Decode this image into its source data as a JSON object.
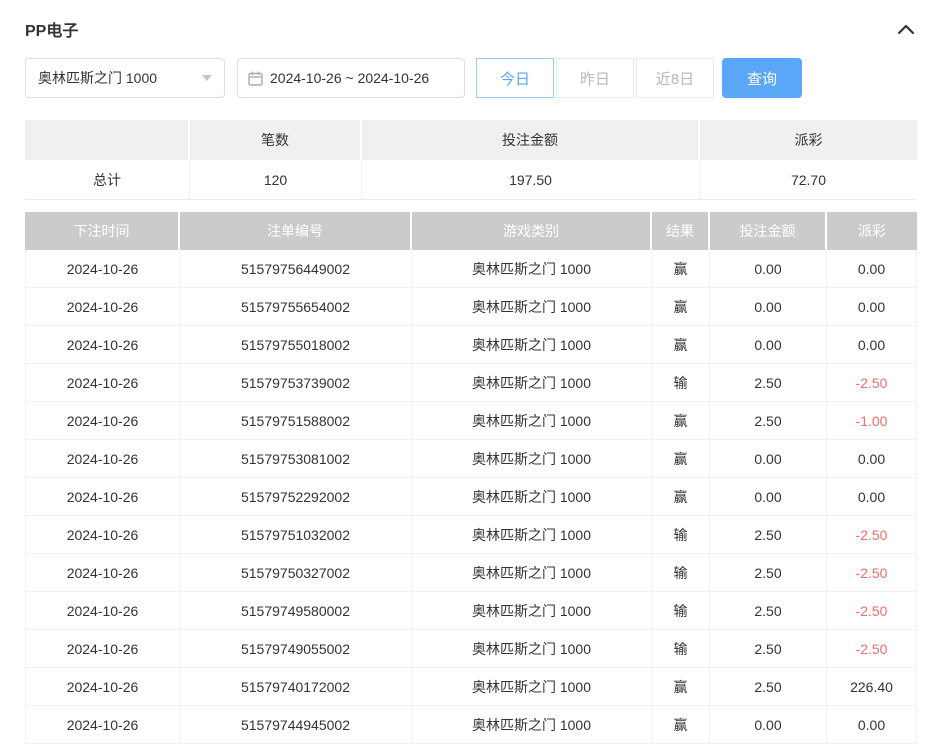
{
  "panel": {
    "title": "PP电子"
  },
  "filters": {
    "game_select": {
      "value": "奥林匹斯之门 1000"
    },
    "date_range": {
      "value": "2024-10-26 ~ 2024-10-26"
    },
    "quick_buttons": [
      {
        "label": "今日",
        "active": true
      },
      {
        "label": "昨日",
        "active": false
      },
      {
        "label": "近8日",
        "active": false
      }
    ],
    "search_button": "查询"
  },
  "summary": {
    "headers": [
      "",
      "笔数",
      "投注金额",
      "派彩"
    ],
    "total": {
      "label": "总计",
      "count": "120",
      "bet_amount": "197.50",
      "payout": "72.70"
    }
  },
  "table": {
    "headers": [
      "下注时间",
      "注单编号",
      "游戏类别",
      "结果",
      "投注金额",
      "派彩"
    ],
    "rows": [
      [
        "2024-10-26",
        "51579756449002",
        "奥林匹斯之门 1000",
        "赢",
        "0.00",
        "0.00"
      ],
      [
        "2024-10-26",
        "51579755654002",
        "奥林匹斯之门 1000",
        "赢",
        "0.00",
        "0.00"
      ],
      [
        "2024-10-26",
        "51579755018002",
        "奥林匹斯之门 1000",
        "赢",
        "0.00",
        "0.00"
      ],
      [
        "2024-10-26",
        "51579753739002",
        "奥林匹斯之门 1000",
        "输",
        "2.50",
        "-2.50"
      ],
      [
        "2024-10-26",
        "51579751588002",
        "奥林匹斯之门 1000",
        "赢",
        "2.50",
        "-1.00"
      ],
      [
        "2024-10-26",
        "51579753081002",
        "奥林匹斯之门 1000",
        "赢",
        "0.00",
        "0.00"
      ],
      [
        "2024-10-26",
        "51579752292002",
        "奥林匹斯之门 1000",
        "赢",
        "0.00",
        "0.00"
      ],
      [
        "2024-10-26",
        "51579751032002",
        "奥林匹斯之门 1000",
        "输",
        "2.50",
        "-2.50"
      ],
      [
        "2024-10-26",
        "51579750327002",
        "奥林匹斯之门 1000",
        "输",
        "2.50",
        "-2.50"
      ],
      [
        "2024-10-26",
        "51579749580002",
        "奥林匹斯之门 1000",
        "输",
        "2.50",
        "-2.50"
      ],
      [
        "2024-10-26",
        "51579749055002",
        "奥林匹斯之门 1000",
        "输",
        "2.50",
        "-2.50"
      ],
      [
        "2024-10-26",
        "51579740172002",
        "奥林匹斯之门 1000",
        "赢",
        "2.50",
        "226.40"
      ],
      [
        "2024-10-26",
        "51579744945002",
        "奥林匹斯之门 1000",
        "赢",
        "0.00",
        "0.00"
      ]
    ]
  },
  "colors": {
    "accent": "#5ba7f7",
    "negative": "#f56c6c",
    "table_header_bg": "#cbcbcb"
  }
}
